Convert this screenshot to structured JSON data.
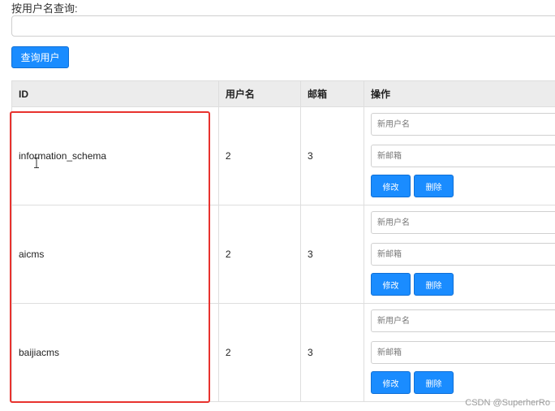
{
  "search": {
    "label": "按用户名查询:",
    "value": "",
    "button_label": "查询用户"
  },
  "table": {
    "headers": [
      "ID",
      "用户名",
      "邮箱",
      "操作"
    ],
    "rows": [
      {
        "id": "information_schema",
        "name": "2",
        "mail": "3"
      },
      {
        "id": "aicms",
        "name": "2",
        "mail": "3"
      },
      {
        "id": "baijiacms",
        "name": "2",
        "mail": "3"
      }
    ],
    "new_name_placeholder": "新用户名",
    "new_mail_placeholder": "新邮箱",
    "edit_label": "修改",
    "delete_label": "删除"
  },
  "watermark": "CSDN @SuperherRo",
  "colors": {
    "accent": "#1a8cff",
    "highlight_box": "#e8322e",
    "header_bg": "#ececec"
  }
}
